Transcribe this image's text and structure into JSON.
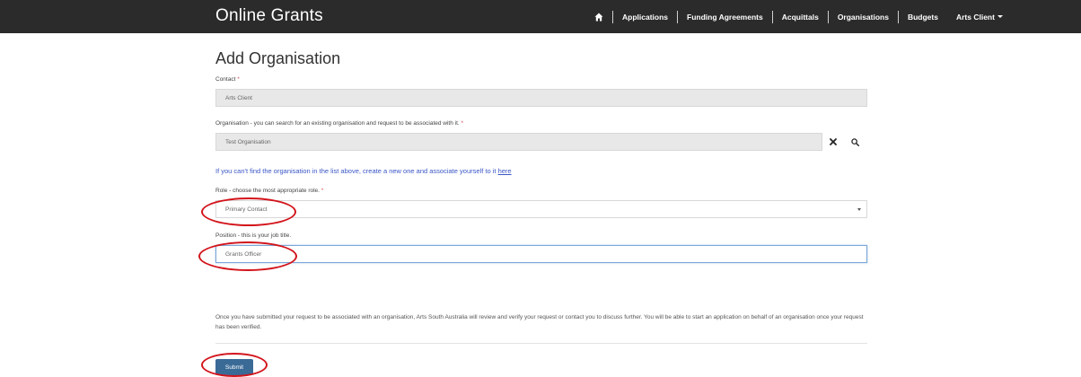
{
  "navbar": {
    "brand": "Online Grants",
    "items": [
      {
        "label": "Applications"
      },
      {
        "label": "Funding Agreements"
      },
      {
        "label": "Acquittals"
      },
      {
        "label": "Organisations"
      },
      {
        "label": "Budgets"
      }
    ],
    "user": "Arts Client"
  },
  "page": {
    "title": "Add Organisation"
  },
  "form": {
    "contact": {
      "label": "Contact",
      "required_mark": "*",
      "value": "Arts Client"
    },
    "organisation": {
      "label": "Organisation - you can search for an existing organisation and request to be associated with it.",
      "required_mark": "*",
      "value": "Test Organisation"
    },
    "create_link": {
      "text": "If you can't find the organisation in the list above, create a new one and associate yourself to it",
      "link_label": "here"
    },
    "role": {
      "label": "Role - choose the most appropriate role.",
      "required_mark": "*",
      "value": "Primary Contact"
    },
    "position": {
      "label": "Position - this is your job title.",
      "value": "Grants Officer"
    },
    "info": "Once you have submitted your request to be associated with an organisation, Arts South Australia will review and verify your request or contact you to discuss further. You will be able to start an application on behalf of an organisation once your request has been verified.",
    "submit_label": "Submit"
  },
  "colors": {
    "navbar_bg": "#2b2b2b",
    "link": "#3a56c6",
    "submit_bg": "#3a6a96",
    "annotation": "#d3141b",
    "required": "#d9534f"
  },
  "icons": {
    "home": "home-icon",
    "clear": "close-icon",
    "search": "search-icon",
    "user_menu": "caret-down-icon",
    "select": "chevron-down-icon"
  }
}
